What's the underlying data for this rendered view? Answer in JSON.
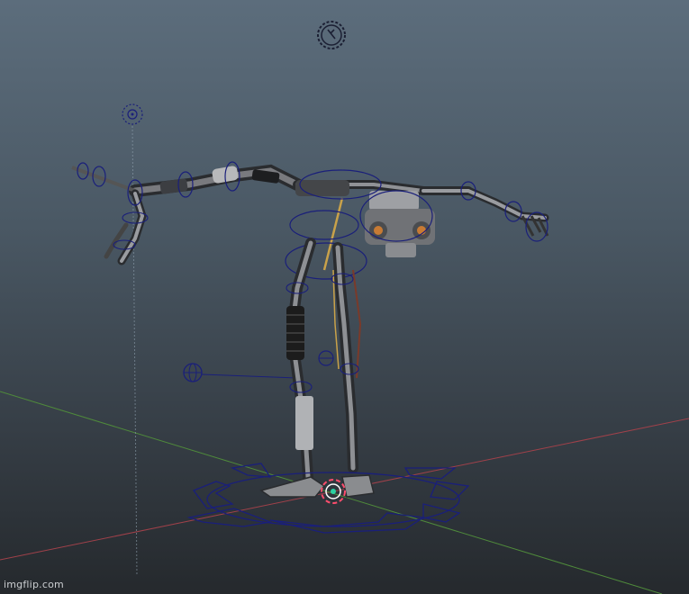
{
  "viewport": {
    "background_top": "#5c6d7c",
    "background_bottom": "#25292d"
  },
  "grid": {
    "x_axis_color": "#a0414a",
    "z_axis_color": "#4f8a3b",
    "y_axis_color": "#8fa0ae"
  },
  "rig": {
    "control_color": "#1a1f7a",
    "metal_color": "#8d8f92",
    "cable_color": "#c9a24a",
    "spring_color": "#1c1c1c",
    "pivot_color": "#ff4d6d"
  },
  "icons": {
    "gear": "gear-icon",
    "locator": "locator-icon",
    "pivot": "pivot-icon"
  },
  "watermark": {
    "text": "imgflip.com"
  }
}
